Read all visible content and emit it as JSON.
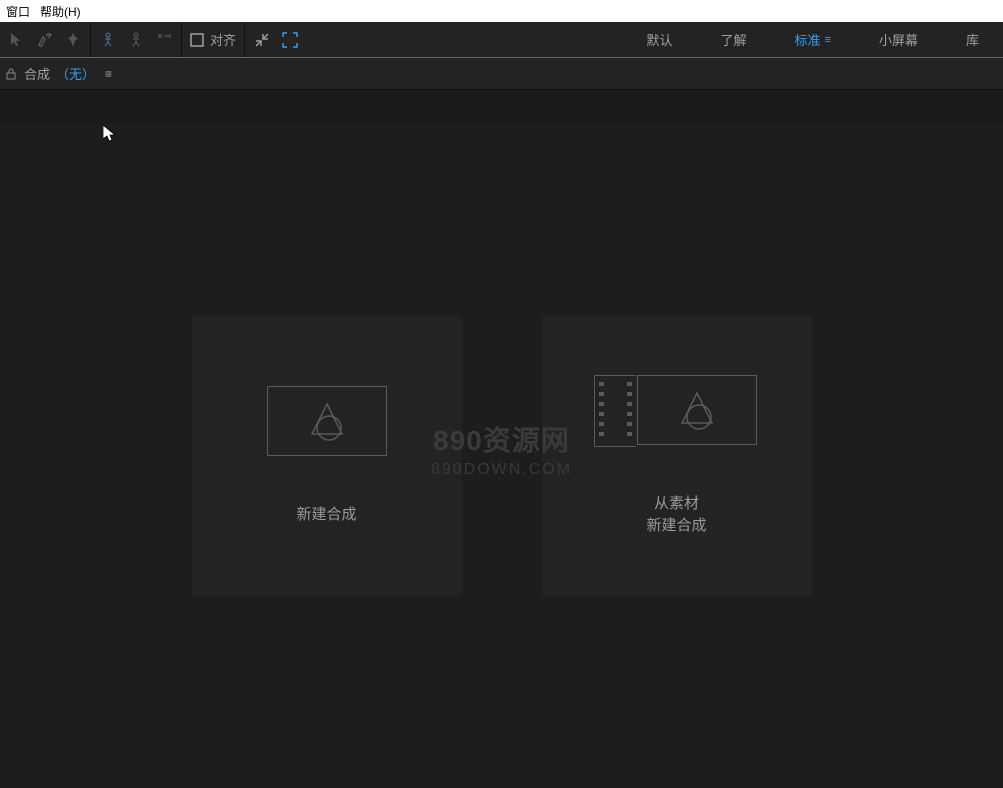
{
  "menubar": {
    "window": "窗口",
    "help": "帮助(H)"
  },
  "toolbar": {
    "snap_label": "对齐"
  },
  "workspace": {
    "tabs": [
      {
        "label": "默认",
        "active": false
      },
      {
        "label": "了解",
        "active": false
      },
      {
        "label": "标准",
        "active": true
      },
      {
        "label": "小屏幕",
        "active": false
      },
      {
        "label": "库",
        "active": false
      }
    ]
  },
  "panel": {
    "title": "合成",
    "none": "（无）"
  },
  "cards": {
    "new_comp": "新建合成",
    "from_footage_line1": "从素材",
    "from_footage_line2": "新建合成"
  },
  "watermark": {
    "main": "890资源网",
    "sub": "890DOWN.COM"
  }
}
